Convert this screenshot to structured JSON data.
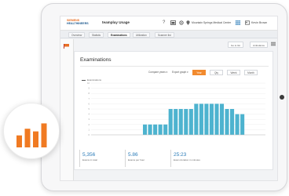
{
  "header": {
    "logo_line1": "Siemens",
    "logo_line2": "Healthineers",
    "app_title": "teamplay Usage",
    "help_icon": "?",
    "facility": "Mountain Springs Medical Center",
    "user": "Kevin Brown"
  },
  "tabs": [
    {
      "label": "Overview",
      "active": false
    },
    {
      "label": "Statistic",
      "active": false
    },
    {
      "label": "Examinations",
      "active": true
    },
    {
      "label": "Utilization",
      "active": false
    },
    {
      "label": "Scanner list",
      "active": false
    }
  ],
  "subbar": {
    "export_label": "Go to list",
    "options_label": "Ambulance"
  },
  "card": {
    "title": "Examinations",
    "compare_label": "Compare years ▾",
    "group_label": "Export graph ▾",
    "periods": [
      {
        "label": "Year",
        "active": true
      },
      {
        "label": "Qty",
        "active": false
      },
      {
        "label": "Week",
        "active": false
      },
      {
        "label": "Month",
        "active": false
      }
    ]
  },
  "chart_data": {
    "type": "bar",
    "series": [
      {
        "name": "Examinations",
        "values": [
          0,
          0,
          0,
          0,
          0,
          0,
          0,
          0,
          0,
          0,
          2,
          2,
          2,
          2,
          2,
          5,
          5,
          5,
          5,
          5,
          6,
          6,
          6,
          6,
          6,
          6,
          5,
          5,
          4,
          4,
          0,
          0,
          0,
          0
        ]
      }
    ],
    "color": "#4db3cf",
    "ylim": [
      0,
      10
    ],
    "yticks": [
      "0",
      "1",
      "2",
      "3",
      "4",
      "5",
      "6",
      "7",
      "8",
      "9",
      "10"
    ],
    "grid": true,
    "legend_position": "top-left"
  },
  "kpis": [
    {
      "value": "5,356",
      "label": "Exams in total"
    },
    {
      "value": "5.86",
      "label": "Exams per hour"
    },
    {
      "value": "25:23",
      "label": "Exam duration in minutes"
    }
  ],
  "colors": {
    "accent_orange": "#f28a2e",
    "bar_blue": "#4db3cf",
    "kpi_blue": "#2a7bb8"
  },
  "badge": {
    "icon": "bar-chart-icon",
    "bar_values": [
      0.45,
      0.7,
      0.6,
      0.9
    ],
    "color": "#f07a22"
  }
}
